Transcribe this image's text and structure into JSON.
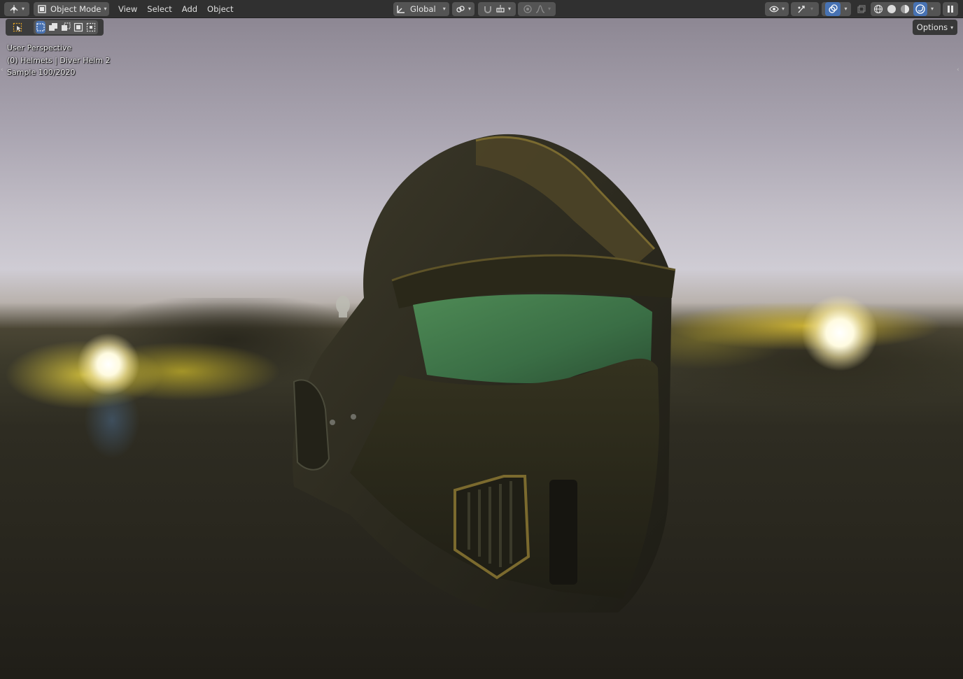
{
  "header": {
    "editor_type_icon": "3d-viewport-editor-icon",
    "mode_label": "Object Mode",
    "menus": [
      "View",
      "Select",
      "Add",
      "Object"
    ],
    "transform_orientation": "Global"
  },
  "toolbar": {
    "options_label": "Options"
  },
  "viewport": {
    "overlay_lines": {
      "perspective": "User Perspective",
      "collection": "(0) Helmets | Diver Helm 2",
      "sample": "Sample 100/2020"
    },
    "shading_mode": "rendered",
    "render_state": "paused"
  },
  "colors": {
    "header_bg": "#303030",
    "active_blue": "#4772b3",
    "button_bg": "#545454"
  }
}
